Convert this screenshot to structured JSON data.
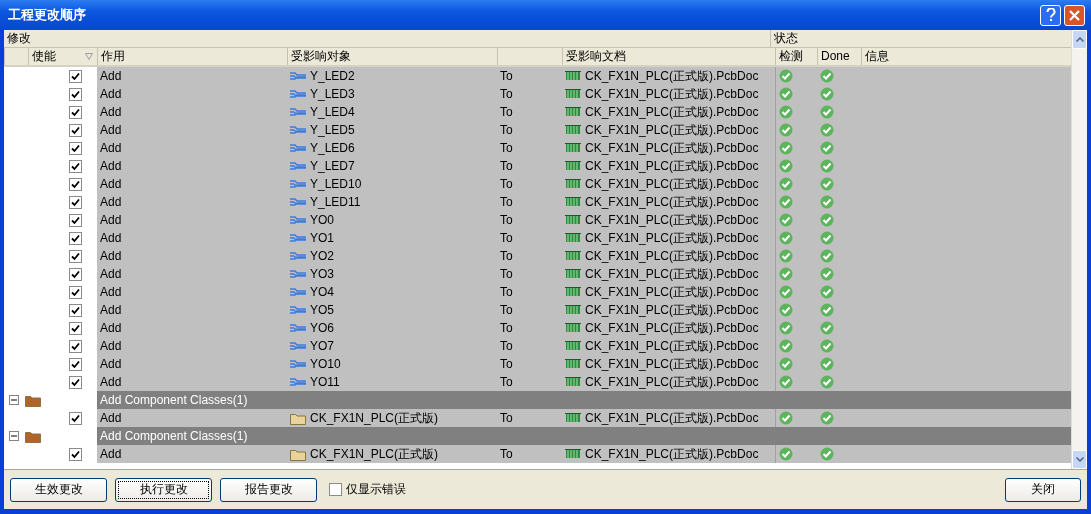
{
  "window": {
    "title": "工程更改顺序"
  },
  "group_headers": {
    "changes": "修改",
    "status": "状态"
  },
  "columns": {
    "enable": "使能",
    "action": "作用",
    "object": "受影响对象",
    "document": "受影响文档",
    "check": "检测",
    "done": "Done",
    "message": "信息"
  },
  "rows": [
    {
      "kind": "net",
      "enabled": true,
      "action": "Add",
      "object": "Y_LED2",
      "to": "To",
      "document": "CK_FX1N_PLC(正式版).PcbDoc",
      "check": true,
      "done": true
    },
    {
      "kind": "net",
      "enabled": true,
      "action": "Add",
      "object": "Y_LED3",
      "to": "To",
      "document": "CK_FX1N_PLC(正式版).PcbDoc",
      "check": true,
      "done": true
    },
    {
      "kind": "net",
      "enabled": true,
      "action": "Add",
      "object": "Y_LED4",
      "to": "To",
      "document": "CK_FX1N_PLC(正式版).PcbDoc",
      "check": true,
      "done": true
    },
    {
      "kind": "net",
      "enabled": true,
      "action": "Add",
      "object": "Y_LED5",
      "to": "To",
      "document": "CK_FX1N_PLC(正式版).PcbDoc",
      "check": true,
      "done": true
    },
    {
      "kind": "net",
      "enabled": true,
      "action": "Add",
      "object": "Y_LED6",
      "to": "To",
      "document": "CK_FX1N_PLC(正式版).PcbDoc",
      "check": true,
      "done": true
    },
    {
      "kind": "net",
      "enabled": true,
      "action": "Add",
      "object": "Y_LED7",
      "to": "To",
      "document": "CK_FX1N_PLC(正式版).PcbDoc",
      "check": true,
      "done": true
    },
    {
      "kind": "net",
      "enabled": true,
      "action": "Add",
      "object": "Y_LED10",
      "to": "To",
      "document": "CK_FX1N_PLC(正式版).PcbDoc",
      "check": true,
      "done": true
    },
    {
      "kind": "net",
      "enabled": true,
      "action": "Add",
      "object": "Y_LED11",
      "to": "To",
      "document": "CK_FX1N_PLC(正式版).PcbDoc",
      "check": true,
      "done": true
    },
    {
      "kind": "net",
      "enabled": true,
      "action": "Add",
      "object": "YO0",
      "to": "To",
      "document": "CK_FX1N_PLC(正式版).PcbDoc",
      "check": true,
      "done": true
    },
    {
      "kind": "net",
      "enabled": true,
      "action": "Add",
      "object": "YO1",
      "to": "To",
      "document": "CK_FX1N_PLC(正式版).PcbDoc",
      "check": true,
      "done": true
    },
    {
      "kind": "net",
      "enabled": true,
      "action": "Add",
      "object": "YO2",
      "to": "To",
      "document": "CK_FX1N_PLC(正式版).PcbDoc",
      "check": true,
      "done": true
    },
    {
      "kind": "net",
      "enabled": true,
      "action": "Add",
      "object": "YO3",
      "to": "To",
      "document": "CK_FX1N_PLC(正式版).PcbDoc",
      "check": true,
      "done": true
    },
    {
      "kind": "net",
      "enabled": true,
      "action": "Add",
      "object": "YO4",
      "to": "To",
      "document": "CK_FX1N_PLC(正式版).PcbDoc",
      "check": true,
      "done": true
    },
    {
      "kind": "net",
      "enabled": true,
      "action": "Add",
      "object": "YO5",
      "to": "To",
      "document": "CK_FX1N_PLC(正式版).PcbDoc",
      "check": true,
      "done": true
    },
    {
      "kind": "net",
      "enabled": true,
      "action": "Add",
      "object": "YO6",
      "to": "To",
      "document": "CK_FX1N_PLC(正式版).PcbDoc",
      "check": true,
      "done": true
    },
    {
      "kind": "net",
      "enabled": true,
      "action": "Add",
      "object": "YO7",
      "to": "To",
      "document": "CK_FX1N_PLC(正式版).PcbDoc",
      "check": true,
      "done": true
    },
    {
      "kind": "net",
      "enabled": true,
      "action": "Add",
      "object": "YO10",
      "to": "To",
      "document": "CK_FX1N_PLC(正式版).PcbDoc",
      "check": true,
      "done": true
    },
    {
      "kind": "net",
      "enabled": true,
      "action": "Add",
      "object": "YO11",
      "to": "To",
      "document": "CK_FX1N_PLC(正式版).PcbDoc",
      "check": true,
      "done": true
    },
    {
      "kind": "group",
      "expanded": true,
      "label": "Add Component Classes(1)"
    },
    {
      "kind": "class",
      "enabled": true,
      "action": "Add",
      "object": "CK_FX1N_PLC(正式版)",
      "to": "To",
      "document": "CK_FX1N_PLC(正式版).PcbDoc",
      "check": true,
      "done": true
    },
    {
      "kind": "group",
      "expanded": true,
      "label": "Add Component Classes(1)"
    },
    {
      "kind": "class",
      "enabled": true,
      "action": "Add",
      "object": "CK_FX1N_PLC(正式版)",
      "to": "To",
      "document": "CK_FX1N_PLC(正式版).PcbDoc",
      "check": true,
      "done": true
    }
  ],
  "footer": {
    "buttons": [
      {
        "label": "生效更改",
        "focused": false
      },
      {
        "label": "执行更改",
        "focused": true
      },
      {
        "label": "报告更改",
        "focused": false
      }
    ],
    "errors_only": {
      "label": "仅显示错误",
      "checked": false
    },
    "close": "关闭"
  }
}
